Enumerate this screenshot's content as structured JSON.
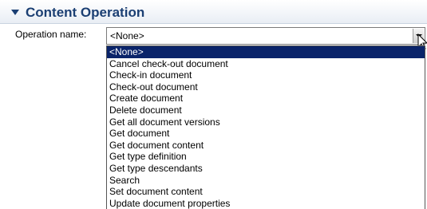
{
  "section": {
    "title": "Content Operation"
  },
  "form": {
    "operation_label": "Operation name:",
    "operation_value": "<None>"
  },
  "dropdown": {
    "items": [
      "<None>",
      "Cancel check-out document",
      "Check-in document",
      "Check-out document",
      "Create document",
      "Delete document",
      "Get all document versions",
      "Get document",
      "Get document content",
      "Get type definition",
      "Get type descendants",
      "Search",
      "Set document content",
      "Update document properties"
    ],
    "selected_index": 0
  },
  "colors": {
    "header_text": "#1b3f73",
    "selection_bg": "#0a246a",
    "selection_fg": "#ffffff"
  },
  "icons": {
    "section_toggle": "triangle-down-icon",
    "combo_arrow": "chevron-down-icon",
    "cursor": "mouse-pointer-icon"
  }
}
